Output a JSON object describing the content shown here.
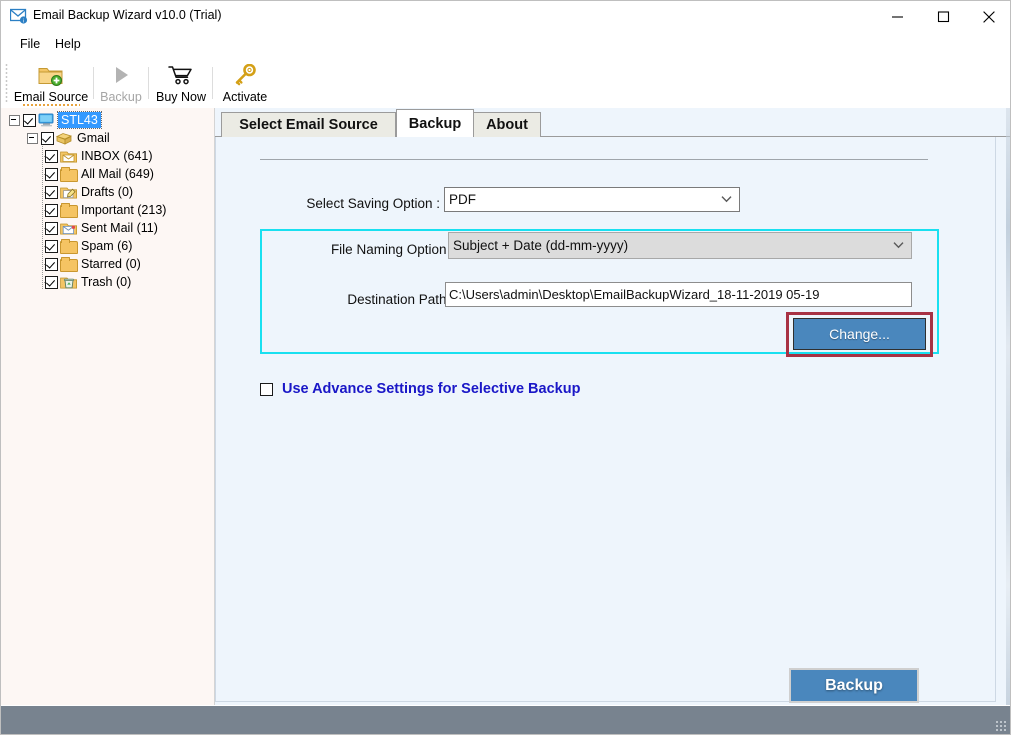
{
  "window": {
    "title": "Email Backup Wizard v10.0 (Trial)",
    "icon": "envelope-icon",
    "minimize": "—",
    "maximize": "□",
    "close": "×"
  },
  "menu": {
    "items": [
      {
        "label": "File"
      },
      {
        "label": "Help"
      }
    ]
  },
  "toolbar": {
    "buttons": [
      {
        "label": "Email Source",
        "icon": "folder-add-icon",
        "enabled": true
      },
      {
        "label": "Backup",
        "icon": "play-triangle-icon",
        "enabled": false
      },
      {
        "label": "Buy Now",
        "icon": "shopping-cart-icon",
        "enabled": true
      },
      {
        "label": "Activate",
        "icon": "key-icon",
        "enabled": true
      }
    ]
  },
  "sidebar": {
    "root": {
      "label": "STL43",
      "icon": "computer-icon",
      "checked": true,
      "selected": true,
      "expanded": true
    },
    "account": {
      "label": "Gmail",
      "icon": "mailbox-stack-icon",
      "checked": true,
      "expanded": true
    },
    "folders": [
      {
        "label": "INBOX (641)",
        "icon": "inbox-folder-icon",
        "checked": true
      },
      {
        "label": "All Mail (649)",
        "icon": "folder-icon",
        "checked": true
      },
      {
        "label": "Drafts (0)",
        "icon": "draft-folder-icon",
        "checked": true
      },
      {
        "label": "Important (213)",
        "icon": "folder-icon",
        "checked": true
      },
      {
        "label": "Sent Mail (11)",
        "icon": "sent-folder-icon",
        "checked": true
      },
      {
        "label": "Spam (6)",
        "icon": "folder-icon",
        "checked": true
      },
      {
        "label": "Starred (0)",
        "icon": "folder-icon",
        "checked": true
      },
      {
        "label": "Trash (0)",
        "icon": "trash-folder-icon",
        "checked": true
      }
    ]
  },
  "tabs": [
    {
      "label": "Select Email Source",
      "active": false
    },
    {
      "label": "Backup",
      "active": true
    },
    {
      "label": "About",
      "active": false
    }
  ],
  "form": {
    "saving_option": {
      "label": "Select Saving Option :",
      "value": "PDF",
      "options": [
        "PDF"
      ]
    },
    "file_naming": {
      "label": "File Naming Option :",
      "value": "Subject + Date (dd-mm-yyyy)",
      "options": [
        "Subject + Date (dd-mm-yyyy)"
      ]
    },
    "destination": {
      "label": "Destination Path :",
      "value": "C:\\Users\\admin\\Desktop\\EmailBackupWizard_18-11-2019 05-19",
      "change_label": "Change..."
    },
    "advance": {
      "label": "Use Advance Settings for Selective Backup",
      "checked": false
    },
    "backup_label": "Backup"
  },
  "colors": {
    "accent_blue": "#4a87bd",
    "highlight_cyan": "#19e0f0",
    "annotation_red": "#a83244",
    "link_blue": "#1a17c7",
    "selection_blue": "#3399ff",
    "panel_bg": "#eef5fc",
    "sidebar_bg": "#fdf7f4",
    "statusbar": "#78838f"
  }
}
